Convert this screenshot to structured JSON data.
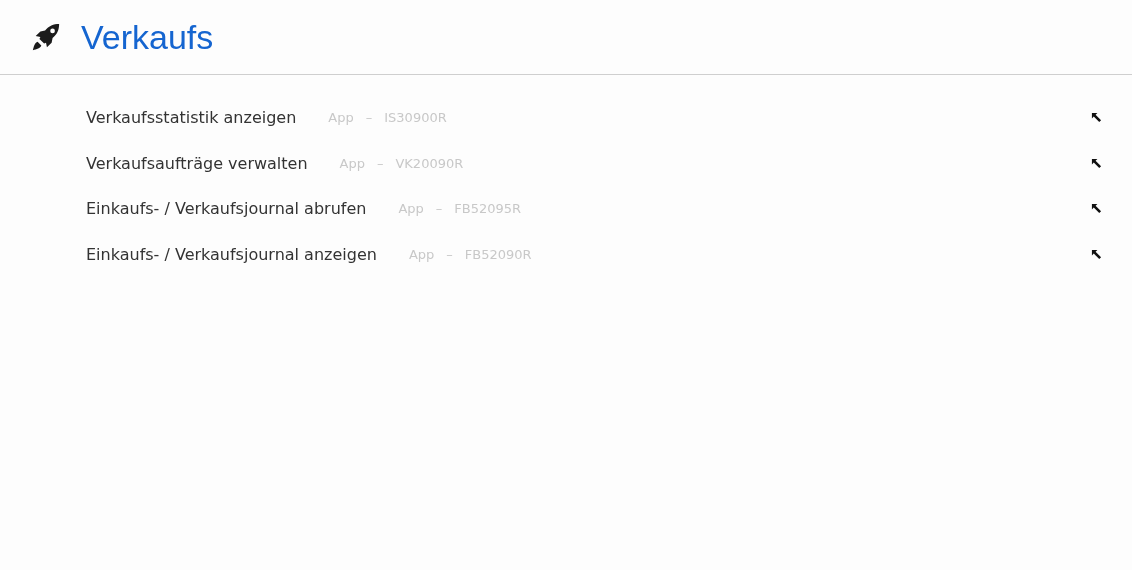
{
  "search": {
    "value": "Verkaufs"
  },
  "results": [
    {
      "title": "Verkaufsstatistik anzeigen",
      "type": "App",
      "separator": "–",
      "code": "IS30900R"
    },
    {
      "title": "Verkaufsaufträge verwalten",
      "type": "App",
      "separator": "–",
      "code": "VK20090R"
    },
    {
      "title": "Einkaufs- / Verkaufsjournal abrufen",
      "type": "App",
      "separator": "–",
      "code": "FB52095R"
    },
    {
      "title": "Einkaufs- / Verkaufsjournal anzeigen",
      "type": "App",
      "separator": "–",
      "code": "FB52090R"
    }
  ]
}
